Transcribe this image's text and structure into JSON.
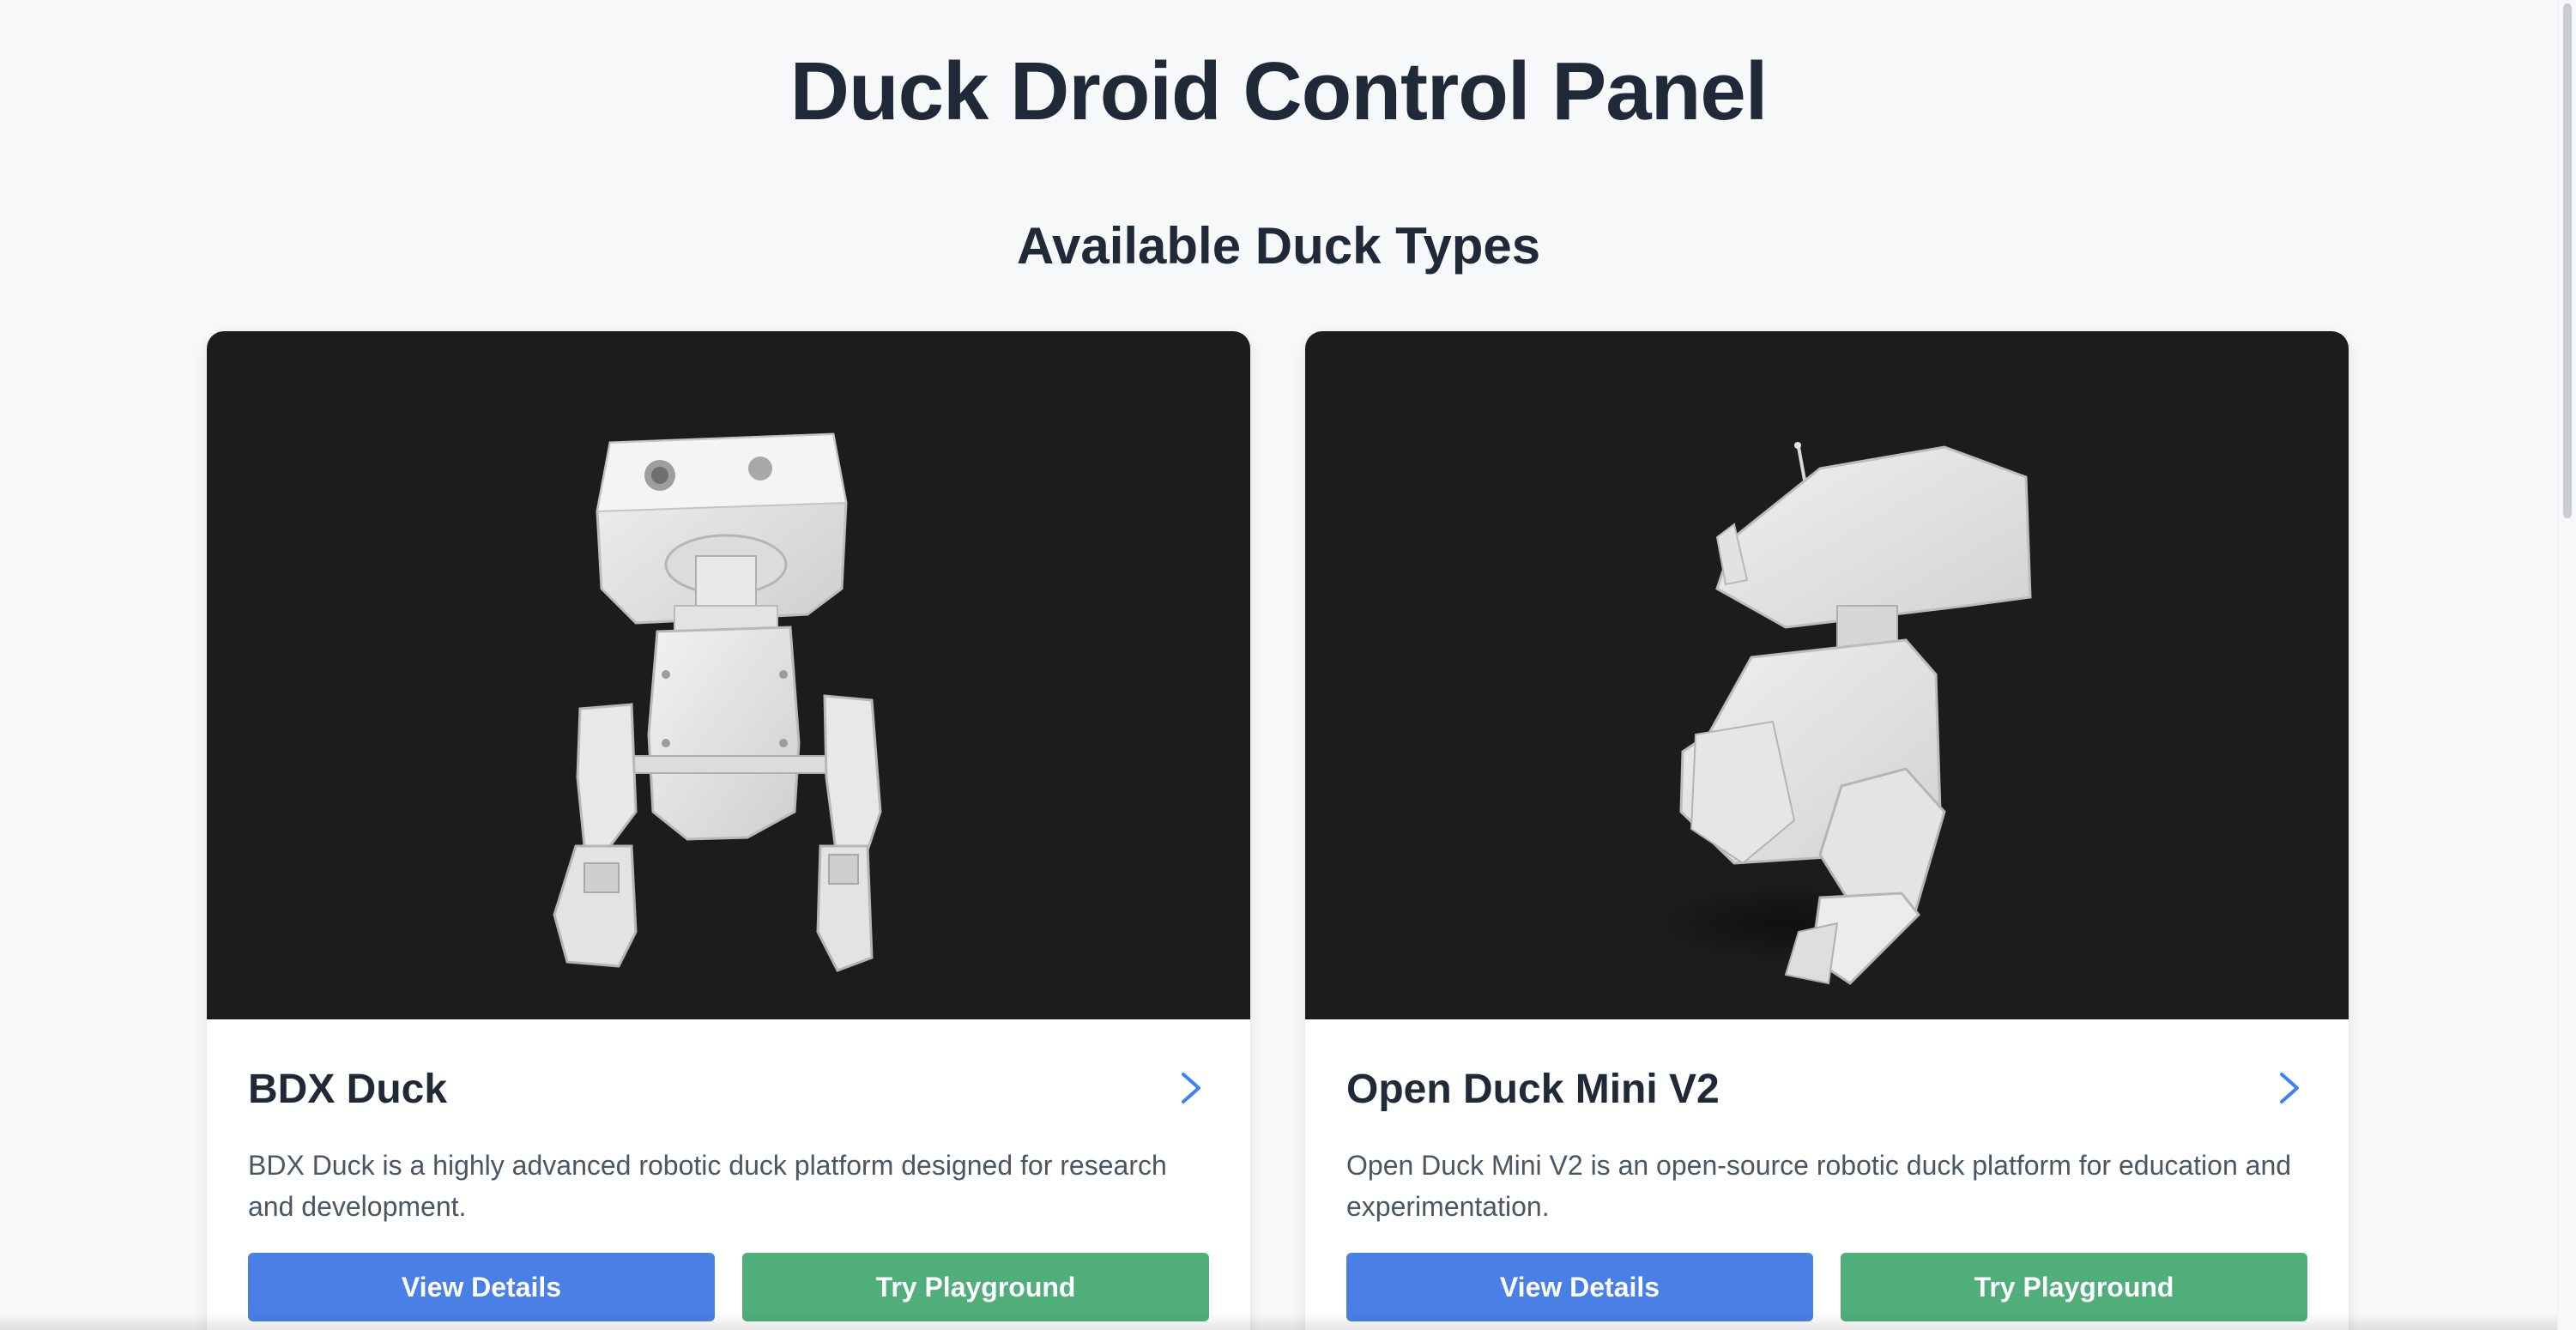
{
  "header": {
    "title": "Duck Droid Control Panel"
  },
  "section": {
    "title": "Available Duck Types"
  },
  "cards": [
    {
      "name": "BDX Duck",
      "description": "BDX Duck is a highly advanced robotic duck platform designed for research and development.",
      "primary_button": "View Details",
      "secondary_button": "Try Playground",
      "media_icon": "robot-3d-model"
    },
    {
      "name": "Open Duck Mini V2",
      "description": "Open Duck Mini V2 is an open-source robotic duck platform for education and experimentation.",
      "primary_button": "View Details",
      "secondary_button": "Try Playground",
      "media_icon": "robot-3d-model"
    }
  ],
  "colors": {
    "background": "#f7f8fa",
    "view_details_button": "#4a7fe6",
    "try_playground_button": "#4fae7a",
    "viewer_background": "#1c1c1c",
    "chevron": "#3b82f6"
  }
}
